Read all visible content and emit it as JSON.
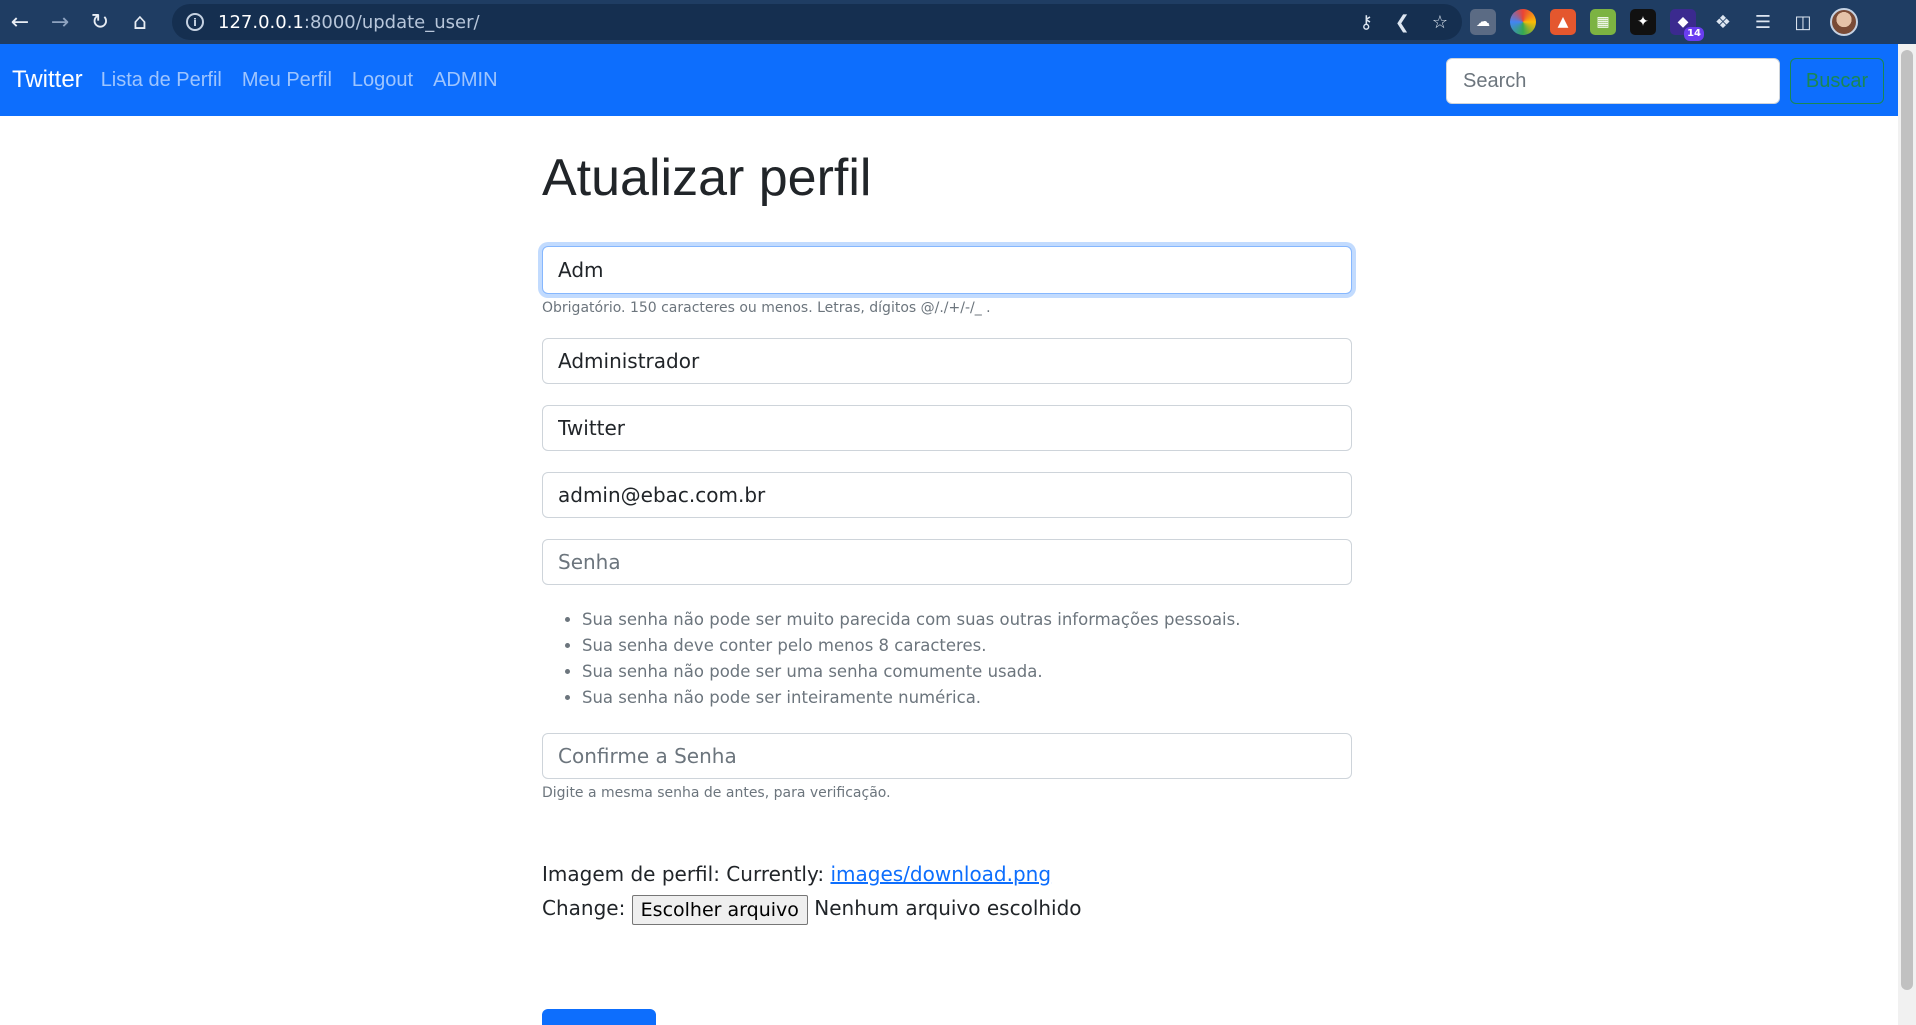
{
  "browser": {
    "url_host": "127.0.0.1",
    "url_path": ":8000/update_user/",
    "ext_badge": "14"
  },
  "navbar": {
    "brand": "Twitter",
    "links": [
      "Lista de Perfil",
      "Meu Perfil",
      "Logout",
      "ADMIN"
    ],
    "search_placeholder": "Search",
    "search_button": "Buscar"
  },
  "form": {
    "title": "Atualizar perfil",
    "username_value": "Adm",
    "username_help": "Obrigatório. 150 caracteres ou menos. Letras, dígitos @/./+/-/_ .",
    "first_name_value": "Administrador",
    "last_name_value": "Twitter",
    "email_value": "admin@ebac.com.br",
    "password_placeholder": "Senha",
    "password_rules": [
      "Sua senha não pode ser muito parecida com suas outras informações pessoais.",
      "Sua senha deve conter pelo menos 8 caracteres.",
      "Sua senha não pode ser uma senha comumente usada.",
      "Sua senha não pode ser inteiramente numérica."
    ],
    "confirm_placeholder": "Confirme a Senha",
    "confirm_help": "Digite a mesma senha de antes, para verificação.",
    "image_label": "Imagem de perfil: Currently: ",
    "image_link": "images/download.png",
    "change_label": "Change: ",
    "file_button": "Escolher arquivo",
    "file_status": " Nenhum arquivo escolhido"
  }
}
